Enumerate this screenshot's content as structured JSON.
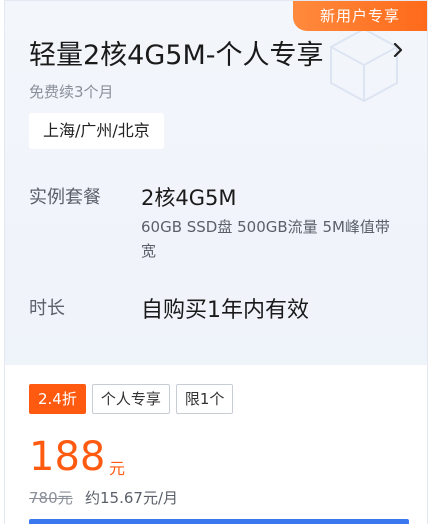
{
  "badge": {
    "label": "新用户专享"
  },
  "product": {
    "title": "轻量2核4G5M-个人专享",
    "subtitle": "免费续3个月",
    "region": "上海/广州/北京"
  },
  "spec": {
    "label": "实例套餐",
    "value": "2核4G5M",
    "desc": "60GB SSD盘 500GB流量 5M峰值带宽"
  },
  "duration": {
    "label": "时长",
    "value": "自购买1年内有效"
  },
  "tags": [
    "2.4折",
    "个人专享",
    "限1个"
  ],
  "price": {
    "amount": "188",
    "unit": "元",
    "original": "780元",
    "monthly": "约15.67元/月"
  },
  "colors": {
    "accent": "#ff5a10",
    "primary": "#3a78f0"
  },
  "icons": {
    "more": "chevron-right-icon"
  }
}
